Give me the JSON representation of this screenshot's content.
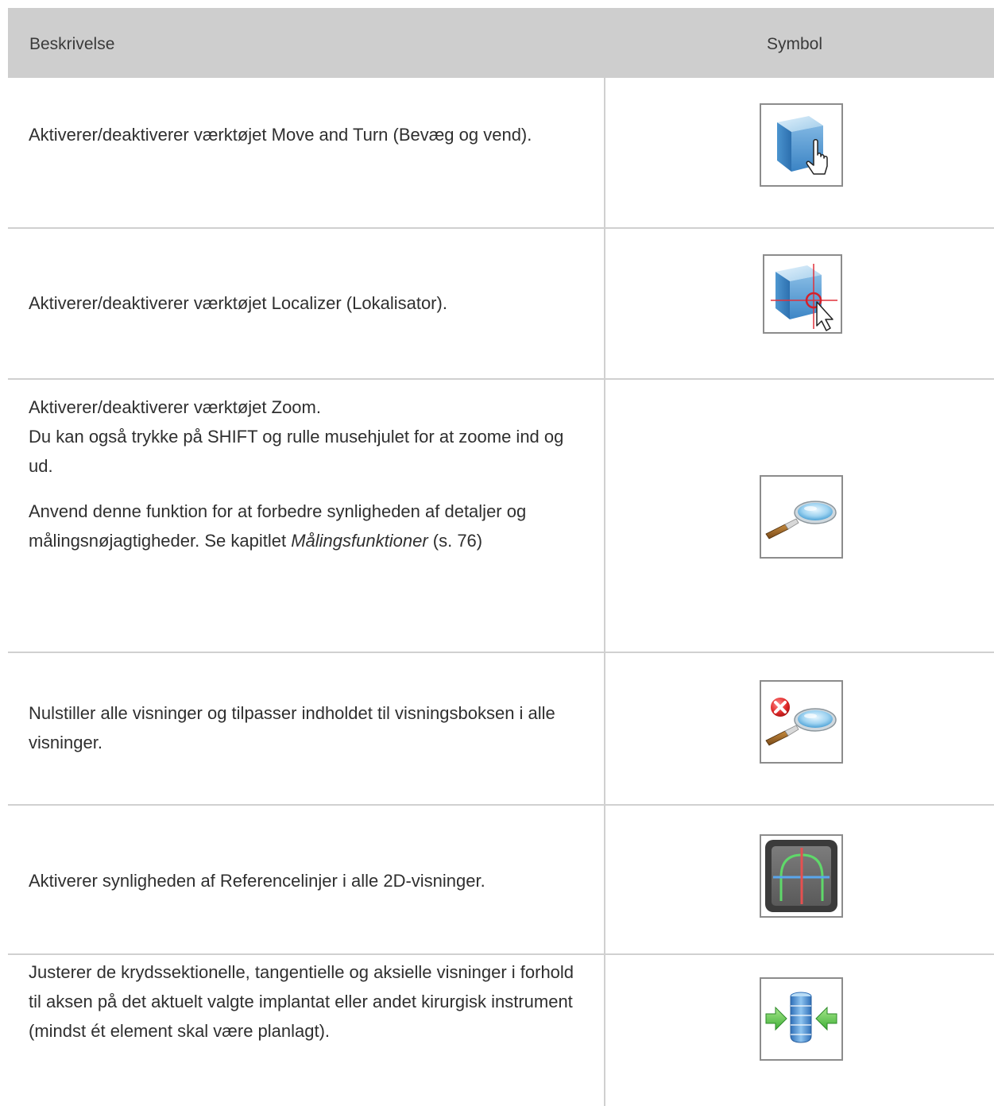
{
  "header": {
    "col1": "Beskrivelse",
    "col2": "Symbol"
  },
  "rows": [
    {
      "text": "Aktiverer/deaktiverer værktøjet Move and Turn (Bevæg og vend).",
      "icon": "move-turn-icon"
    },
    {
      "text": "Aktiverer/deaktiverer værktøjet Localizer (Lokalisator).",
      "icon": "localizer-icon"
    },
    {
      "text1": "Aktiverer/deaktiverer værktøjet Zoom.",
      "text2": "Du kan også trykke på SHIFT og rulle musehjulet for at zoome ind og ud.",
      "text3": "Anvend denne funktion for at forbedre synligheden af detaljer og målingsnøjagtigheder. Se kapitlet",
      "link": "Målingsfunktioner",
      "suffix": " (s. 76)",
      "icon": "zoom-icon"
    },
    {
      "text": "Nulstiller alle visninger og tilpasser indholdet til visningsboksen i alle visninger.",
      "icon": "reset-zoom-icon"
    },
    {
      "text": "Aktiverer synligheden af Referencelinjer i alle 2D-visninger.",
      "icon": "reference-lines-icon"
    },
    {
      "text": "Justerer de krydssektionelle, tangentielle og aksielle visninger i forhold til aksen på det aktuelt valgte implantat eller andet kirurgisk instrument (mindst ét element skal være planlagt).",
      "icon": "align-implant-icon"
    }
  ]
}
